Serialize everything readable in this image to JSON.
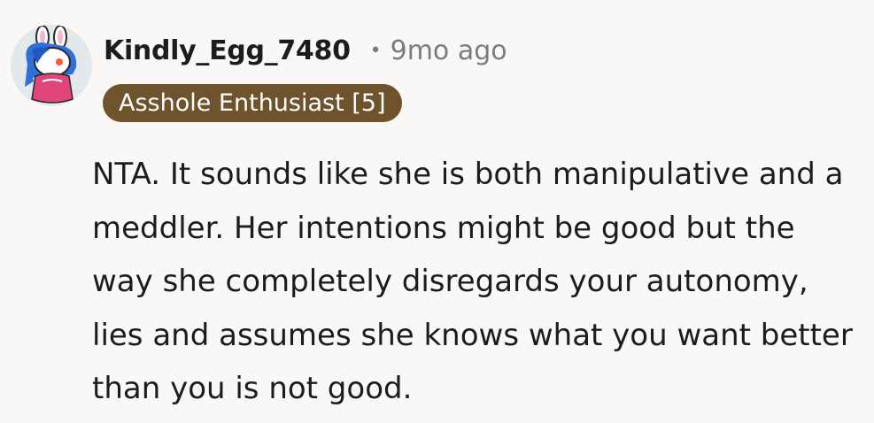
{
  "comment": {
    "username": "Kindly_Egg_7480",
    "separator": "•",
    "timestamp": "9mo ago",
    "flair": "Asshole Enthusiast [5]",
    "body": "NTA. It sounds like she is both manipulative and a meddler. Her intentions might be good but the way she completely disregards your autonomy, lies and assumes she knows what you want better than you is not good.",
    "avatar_icon": "snoo-avatar-icon"
  },
  "colors": {
    "background": "#faf8f6",
    "flair_background": "#6e532d",
    "flair_text": "#ffffff",
    "text_primary": "#1c1c1c",
    "text_muted": "#7c7c7c"
  }
}
